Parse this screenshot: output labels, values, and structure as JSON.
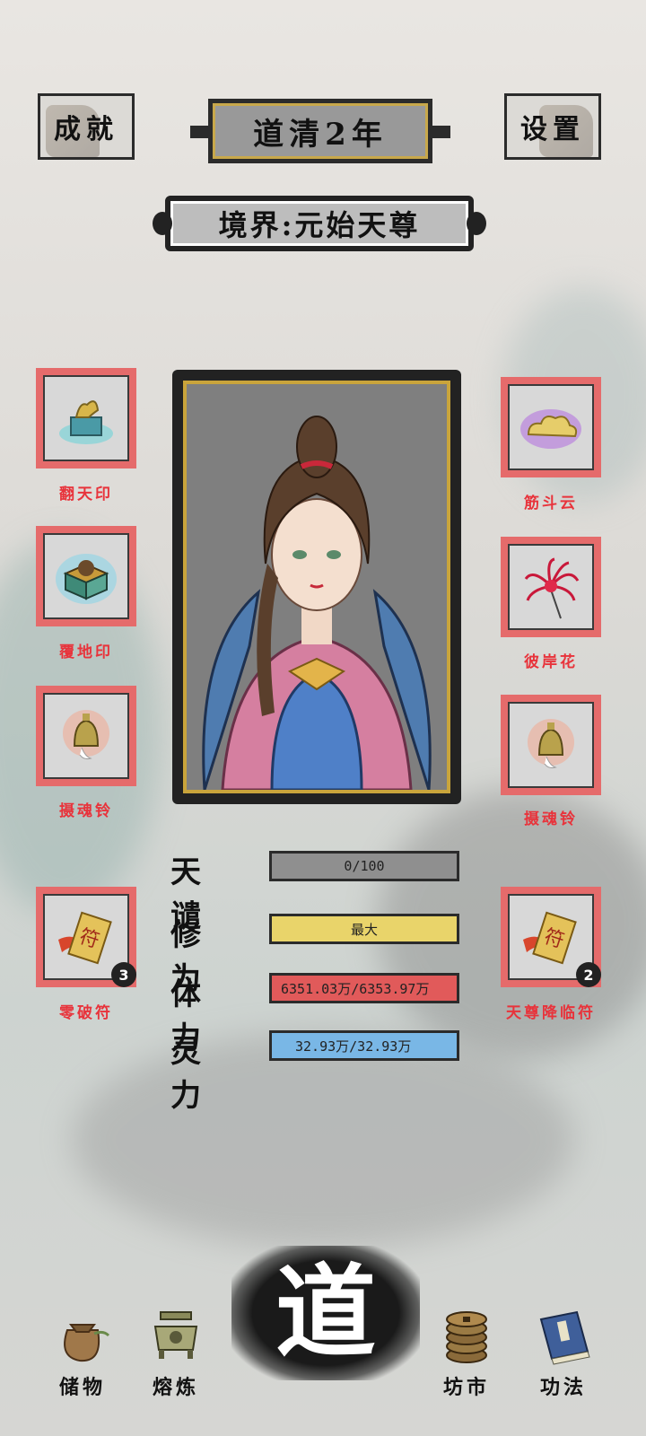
{
  "header": {
    "achievements_label": "成就",
    "settings_label": "设置",
    "era_title": "道清2年",
    "realm_text": "境界:元始天尊"
  },
  "left_items": [
    {
      "label": "翻天印",
      "icon": "seal-box-icon",
      "count": null
    },
    {
      "label": "覆地印",
      "icon": "earth-seal-icon",
      "count": null
    },
    {
      "label": "摄魂铃",
      "icon": "bell-icon",
      "count": null
    },
    {
      "label": "零破符",
      "icon": "talisman-icon",
      "count": "3"
    }
  ],
  "right_items": [
    {
      "label": "筋斗云",
      "icon": "cloud-icon",
      "count": null
    },
    {
      "label": "彼岸花",
      "icon": "spider-lily-icon",
      "count": null
    },
    {
      "label": "摄魂铃",
      "icon": "bell-icon",
      "count": null
    },
    {
      "label": "天尊降临符",
      "icon": "talisman-icon",
      "count": "2"
    }
  ],
  "stats": [
    {
      "label": "天谴",
      "value": "0/100",
      "color": "#8f8f8f",
      "fill": 1.0
    },
    {
      "label": "修为",
      "value": "最大",
      "color": "#e9d46a",
      "fill": 1.0
    },
    {
      "label": "体力",
      "value": "6351.03万/6353.97万",
      "color": "#e15a5a",
      "fill": 1.0
    },
    {
      "label": "灵力",
      "value": "32.93万/32.93万",
      "color": "#79b7e6",
      "fill": 1.0
    }
  ],
  "nav": {
    "storage": "储物",
    "smelt": "熔炼",
    "dao": "道",
    "market": "坊市",
    "techniques": "功法"
  }
}
